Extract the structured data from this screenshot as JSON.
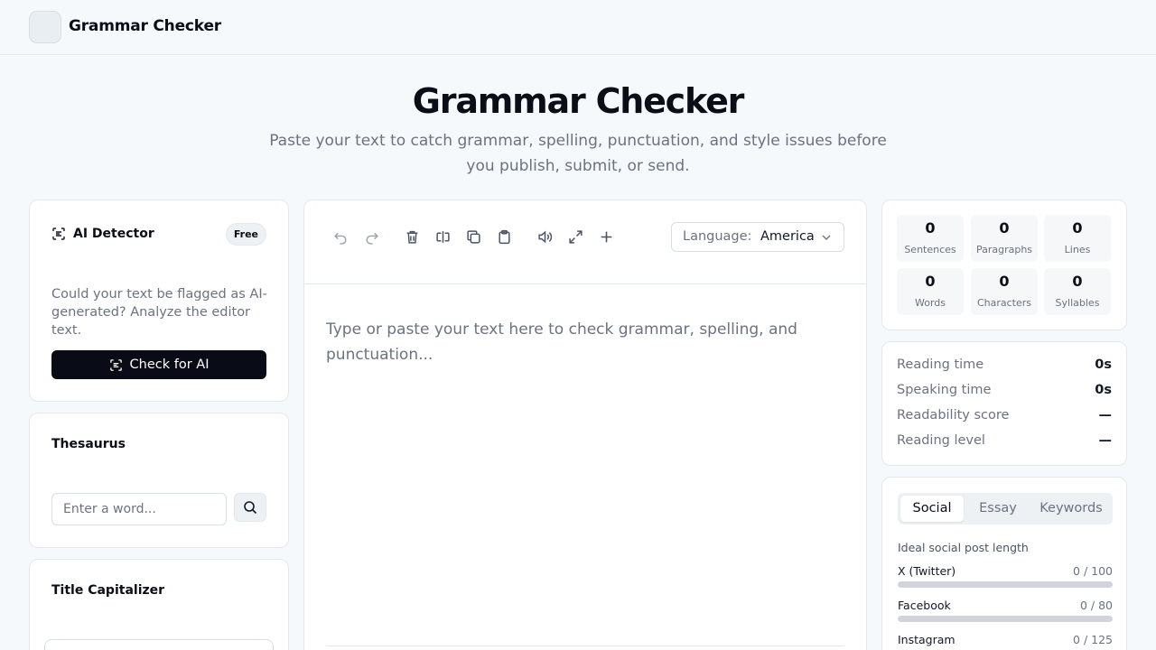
{
  "header": {
    "brand": "Grammar Checker",
    "logo_icon": "logo-square"
  },
  "hero": {
    "title": "Grammar Checker",
    "subtitle": "Paste your text to catch grammar, spelling, punctuation, and style issues before you publish, submit, or send."
  },
  "ai_detector": {
    "icon": "ai-scan-icon",
    "title": "AI Detector",
    "badge": "Free",
    "description": "Could your text be flagged as AI-generated? Analyze the editor text.",
    "button_label": "Check for AI"
  },
  "thesaurus": {
    "title": "Thesaurus",
    "input_placeholder": "Enter a word...",
    "search_icon": "search-icon"
  },
  "title_capitalizer": {
    "title": "Title Capitalizer"
  },
  "editor": {
    "toolbar": [
      "undo-icon",
      "redo-icon",
      "trash-icon",
      "text-cursor-icon",
      "copy-icon",
      "clipboard-icon",
      "speaker-icon",
      "expand-icon",
      "plus-icon"
    ],
    "language_label": "Language:",
    "language_value": "American English",
    "placeholder": "Type or paste your text here to check grammar, spelling, and punctuation..."
  },
  "stats": [
    {
      "value": "0",
      "label": "Sentences"
    },
    {
      "value": "0",
      "label": "Paragraphs"
    },
    {
      "value": "0",
      "label": "Lines"
    },
    {
      "value": "0",
      "label": "Words"
    },
    {
      "value": "0",
      "label": "Characters"
    },
    {
      "value": "0",
      "label": "Syllables"
    }
  ],
  "reading": [
    {
      "label": "Reading time",
      "value": "0s"
    },
    {
      "label": "Speaking time",
      "value": "0s"
    },
    {
      "label": "Readability score",
      "value": "—"
    },
    {
      "label": "Reading level",
      "value": "—"
    }
  ],
  "social": {
    "tabs": [
      "Social",
      "Essay",
      "Keywords"
    ],
    "active_tab": "Social",
    "heading": "Ideal social post length",
    "items": [
      {
        "name": "X (Twitter)",
        "count": "0 / 100",
        "progress": 0
      },
      {
        "name": "Facebook",
        "count": "0 / 80",
        "progress": 0
      },
      {
        "name": "Instagram",
        "count": "0 / 125",
        "progress": 0
      }
    ]
  },
  "colors": {
    "primary": "#090b16",
    "background": "#f5f9fc",
    "muted": "#6b7280",
    "border": "#e3e8ee"
  }
}
